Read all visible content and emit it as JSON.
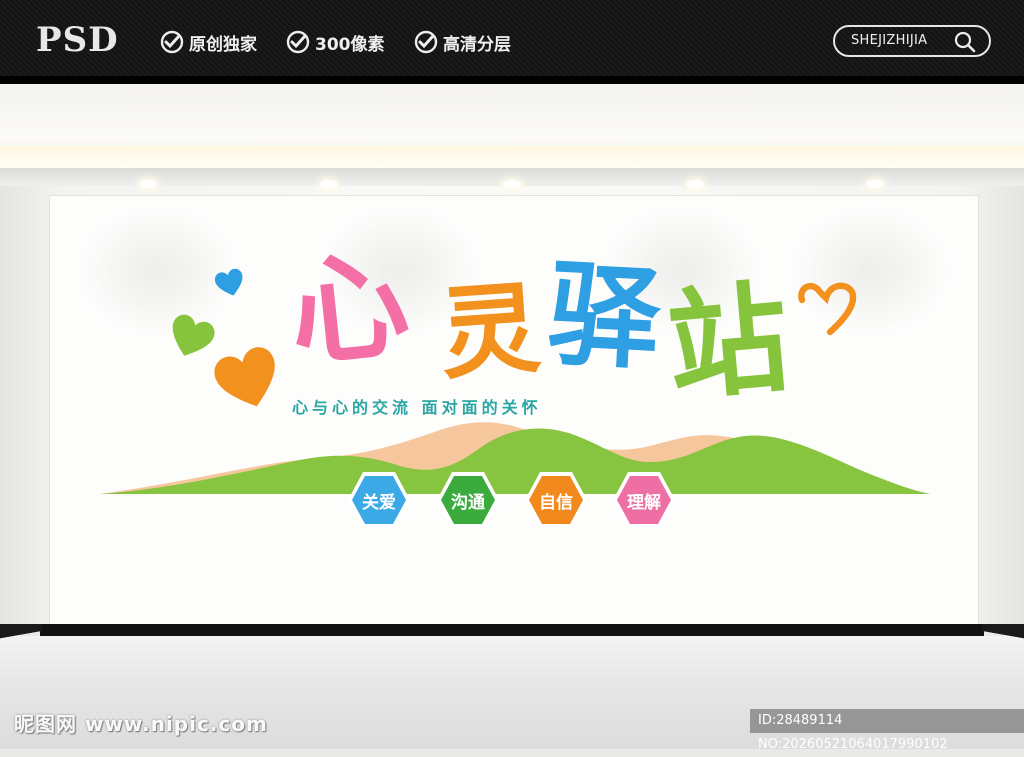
{
  "header": {
    "logo": "PSD",
    "features": [
      "原创独家",
      "300像素",
      "高清分层"
    ],
    "search_text": "SHEJIZHIJIA"
  },
  "sign": {
    "title_chars": [
      "心",
      "灵",
      "驿",
      "站"
    ],
    "subtitle": "心与心的交流  面对面的关怀",
    "badges": [
      {
        "label": "关爱",
        "color": "#3aa9e6"
      },
      {
        "label": "沟通",
        "color": "#3bab3e"
      },
      {
        "label": "自信",
        "color": "#f2891d"
      },
      {
        "label": "理解",
        "color": "#ee6fa4"
      }
    ]
  },
  "colors": {
    "pink": "#f46fa6",
    "orange": "#f3911f",
    "blue": "#2e9fe2",
    "green": "#86c43d",
    "peach": "#f6c59b"
  },
  "watermark": {
    "left": "昵图网 www.nipic.com",
    "right": "ID:28489114 NO:20260521064017990102"
  }
}
